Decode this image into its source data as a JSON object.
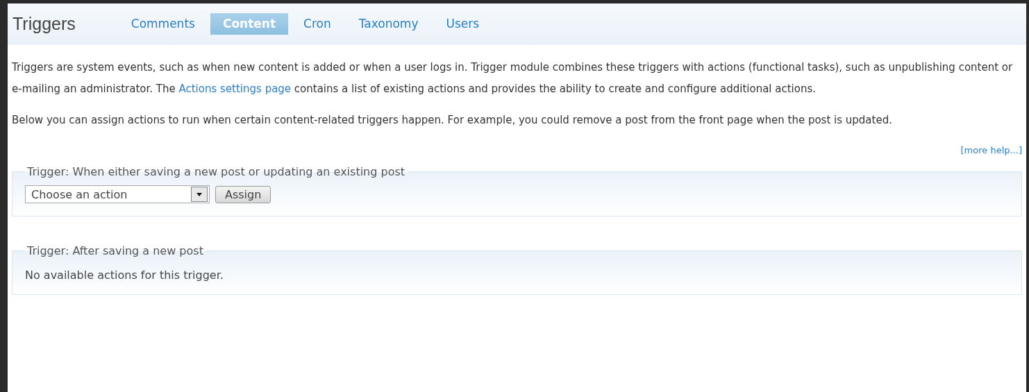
{
  "header": {
    "title": "Triggers"
  },
  "tabs": [
    {
      "label": "Comments",
      "selected": false
    },
    {
      "label": "Content",
      "selected": true
    },
    {
      "label": "Cron",
      "selected": false
    },
    {
      "label": "Taxonomy",
      "selected": false
    },
    {
      "label": "Users",
      "selected": false
    }
  ],
  "paragraphs": [
    [
      {
        "kind": "text",
        "text": "Triggers are system events, such as when new content is added or when a user logs in. Trigger module combines these triggers with actions (functional tasks), such as unpublishing content or e-mailing an administrator. The "
      },
      {
        "kind": "link",
        "text": "Actions settings page"
      },
      {
        "kind": "text",
        "text": " contains a list of existing actions and provides the ability to create and configure additional actions."
      }
    ],
    [
      {
        "kind": "text",
        "text": "Below you can assign actions to run when certain content-related triggers happen. For example, you could remove a post from the front page when the post is updated."
      }
    ]
  ],
  "more_help": "[more help...]",
  "triggers": [
    {
      "legend": "Trigger: When either saving a new post or updating an existing post",
      "kind": "form",
      "select": {
        "value": "Choose an action"
      },
      "button": "Assign"
    },
    {
      "legend": "Trigger: After saving a new post",
      "kind": "message",
      "message": "No available actions for this trigger."
    }
  ]
}
